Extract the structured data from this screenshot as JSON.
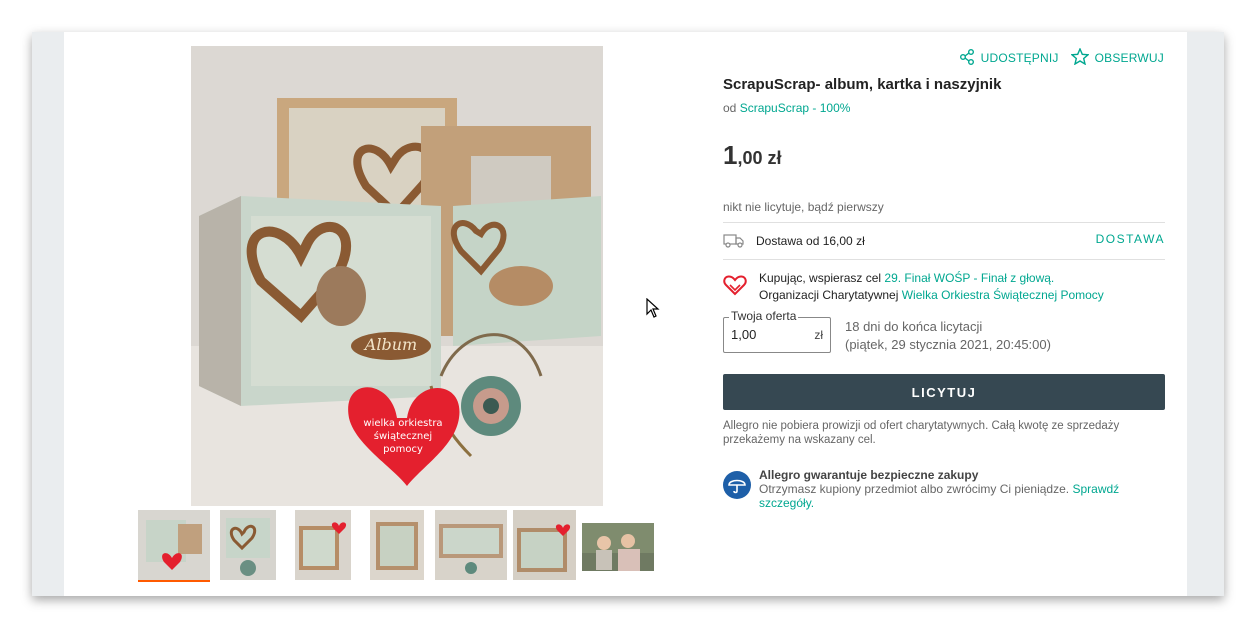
{
  "listing": {
    "title": "ScrapuScrap- album, kartka i naszyjnik",
    "seller_prefix": "od",
    "seller_name": "ScrapuScrap - 100%",
    "price_main": "1",
    "price_rest": ",00 zł",
    "bid_status": "nikt nie licytuje, bądź pierwszy"
  },
  "actions": {
    "share_label": "UDOSTĘPNIJ",
    "watch_label": "OBSERWUJ"
  },
  "delivery": {
    "text": "Dostawa od 16,00 zł",
    "link": "DOSTAWA"
  },
  "charity": {
    "line1_prefix": "Kupując, wspierasz cel",
    "line1_link": "29. Finał WOŚP - Finał z głową.",
    "line2_prefix": "Organizacji Charytatywnej",
    "line2_link": "Wielka Orkiestra Świątecznej Pomocy"
  },
  "offer": {
    "legend": "Twoja oferta",
    "value": "1,00",
    "currency": "zł"
  },
  "time_left": {
    "line1": "18 dni do końca licytacji",
    "line2": "(piątek, 29 stycznia 2021, 20:45:00)"
  },
  "bid_button": "LICYTUJ",
  "note": "Allegro nie pobiera prowizji od ofert charytatywnych. Całą kwotę ze sprzedaży przekażemy na wskazany cel.",
  "guarantee": {
    "title": "Allegro gwarantuje bezpieczne zakupy",
    "text": "Otrzymasz kupiony przedmiot albo zwrócimy Ci pieniądze.",
    "link": "Sprawdź szczegóły."
  },
  "photo": {
    "badge_text": "wielka orkiestra świątecznej pomocy",
    "album_text": "Album"
  },
  "thumbnails": 7,
  "active_thumbnail": 1,
  "colors": {
    "accent": "#00a790",
    "button": "#364852",
    "active_thumb": "#ff5a00",
    "heart": "#e4202e"
  }
}
